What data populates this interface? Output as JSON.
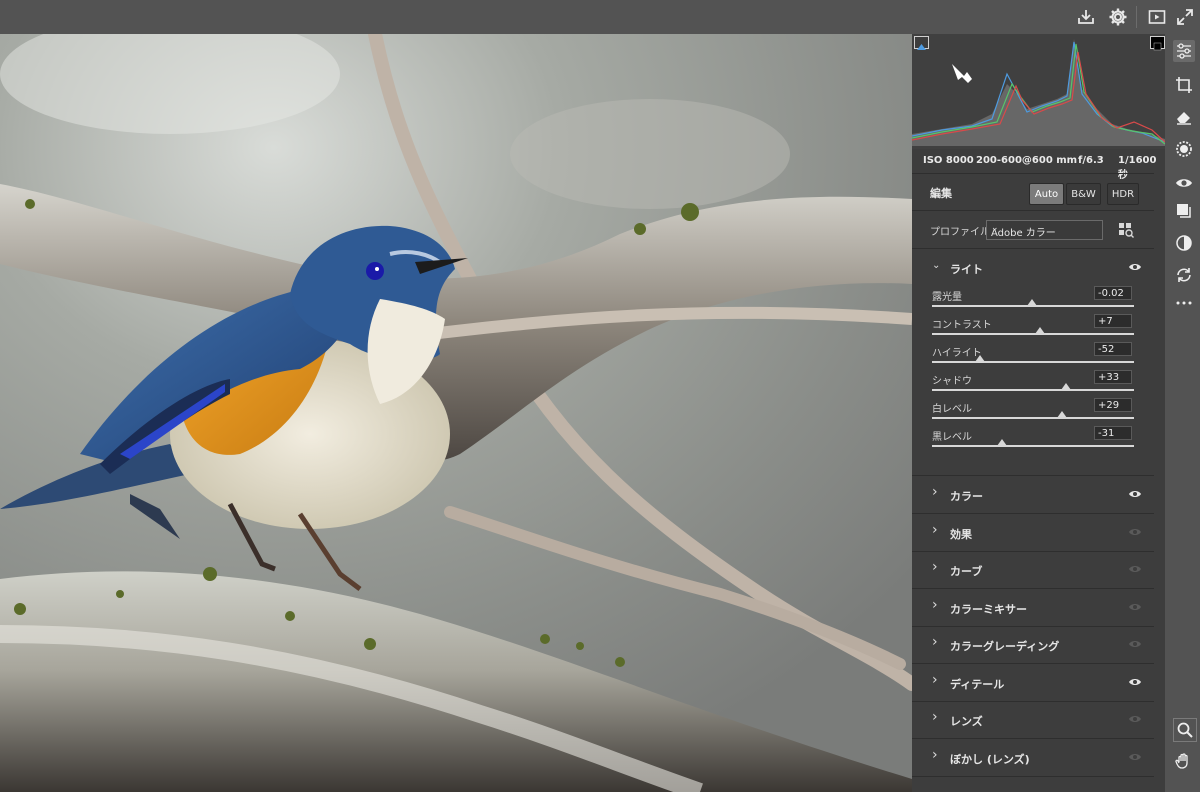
{
  "topbar": {
    "icons": [
      "save-icon",
      "gear-icon",
      "fullscreen-preview-icon",
      "expand-icon"
    ]
  },
  "histogram": {
    "clip_shadow_icon": "triangle-icon",
    "clip_highlight_icon": "square-icon"
  },
  "exif": {
    "iso": "ISO 8000",
    "lens": "200-600@600 mm",
    "aperture": "f/6.3",
    "shutter": "1/1600 秒"
  },
  "edit": {
    "title": "編集",
    "modes": [
      "Auto",
      "B&W",
      "HDR"
    ],
    "active_mode": "Auto"
  },
  "profile": {
    "label": "プロファイル",
    "value": "Adobe カラー"
  },
  "light": {
    "title": "ライト",
    "sliders": [
      {
        "label": "露光量",
        "value": "-0.02",
        "level": 0.495
      },
      {
        "label": "コントラスト",
        "value": "+7",
        "level": 0.535
      },
      {
        "label": "ハイライト",
        "value": "-52",
        "level": 0.24
      },
      {
        "label": "シャドウ",
        "value": "+33",
        "level": 0.665
      },
      {
        "label": "白レベル",
        "value": "+29",
        "level": 0.645
      },
      {
        "label": "黒レベル",
        "value": "-31",
        "level": 0.345
      }
    ]
  },
  "sections": [
    {
      "label": "カラー",
      "visible": true
    },
    {
      "label": "効果",
      "visible": false
    },
    {
      "label": "カーブ",
      "visible": false
    },
    {
      "label": "カラーミキサー",
      "visible": false
    },
    {
      "label": "カラーグレーディング",
      "visible": false
    },
    {
      "label": "ディテール",
      "visible": true
    },
    {
      "label": "レンズ",
      "visible": false
    },
    {
      "label": "ぼかし (レンズ)",
      "visible": false
    }
  ],
  "tools": [
    "edit-sliders-icon",
    "crop-icon",
    "eraser-icon",
    "mask-icon",
    "redeye-icon",
    "presets-icon",
    "adjust-icon",
    "snapshots-icon",
    "more-icon",
    "zoom-icon",
    "hand-icon"
  ],
  "colors": {
    "panel": "#3d3d3d",
    "chrome": "#535353",
    "accent": "#4e9be0"
  }
}
